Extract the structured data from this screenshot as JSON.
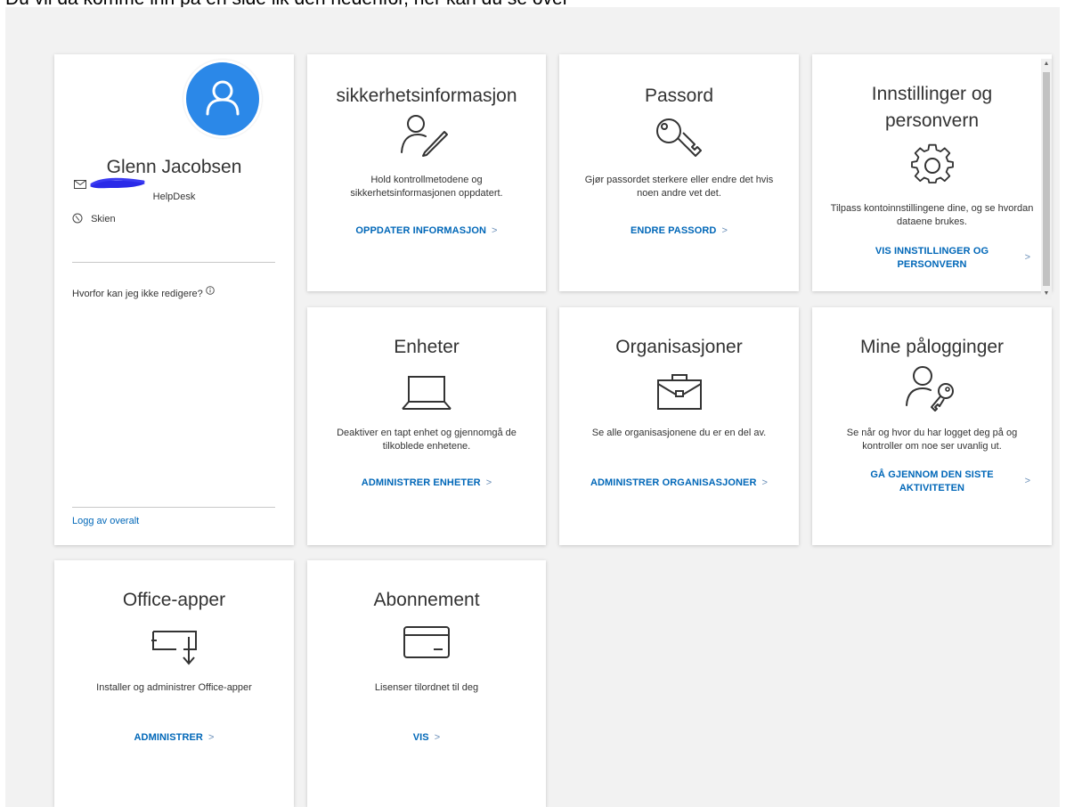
{
  "caption": "Du vil da komme inn på en side lik den nedenfor, her kan du se over",
  "profile": {
    "name": "Glenn Jacobsen",
    "role": "HelpDesk",
    "location": "Skien",
    "why_edit": "Hvorfor kan jeg ikke redigere?",
    "signout": "Logg av overalt",
    "avatar_color": "#2b88e8"
  },
  "cards": {
    "security": {
      "title": "sikkerhetsinformasjon",
      "desc": "Hold kontrollmetodene og sikkerhetsinformasjonen oppdatert.",
      "action": "OPPDATER INFORMASJON",
      "icon": "person-edit-icon"
    },
    "password": {
      "title": "Passord",
      "desc": "Gjør passordet sterkere eller endre det hvis noen andre vet det.",
      "action": "ENDRE PASSORD",
      "icon": "key-icon"
    },
    "settings": {
      "title": "Innstillinger og personvern",
      "desc": "Tilpass kontoinnstillingene dine, og se hvordan dataene brukes.",
      "action": "VIS INNSTILLINGER OG PERSONVERN",
      "icon": "gear-icon"
    },
    "devices": {
      "title": "Enheter",
      "desc": "Deaktiver en tapt enhet og gjennomgå de tilkoblede enhetene.",
      "action": "ADMINISTRER ENHETER",
      "icon": "laptop-icon"
    },
    "organizations": {
      "title": "Organisasjoner",
      "desc": "Se alle organisasjonene du er en del av.",
      "action": "ADMINISTRER ORGANISASJONER",
      "icon": "briefcase-icon"
    },
    "signins": {
      "title": "Mine pålogginger",
      "desc": "Se når og hvor du har logget deg på og kontroller om noe ser uvanlig ut.",
      "action": "GÅ GJENNOM DEN SISTE AKTIVITETEN",
      "icon": "person-key-icon"
    },
    "office": {
      "title": "Office-apper",
      "desc": "Installer og administrer Office-apper",
      "action": "ADMINISTRER",
      "icon": "download-device-icon"
    },
    "subscriptions": {
      "title": "Abonnement",
      "desc": "Lisenser tilordnet til deg",
      "action": "VIS",
      "icon": "credit-card-icon"
    }
  },
  "chevron": ">",
  "colors": {
    "link": "#0067b8",
    "background": "#f2f2f2",
    "card": "#ffffff"
  }
}
